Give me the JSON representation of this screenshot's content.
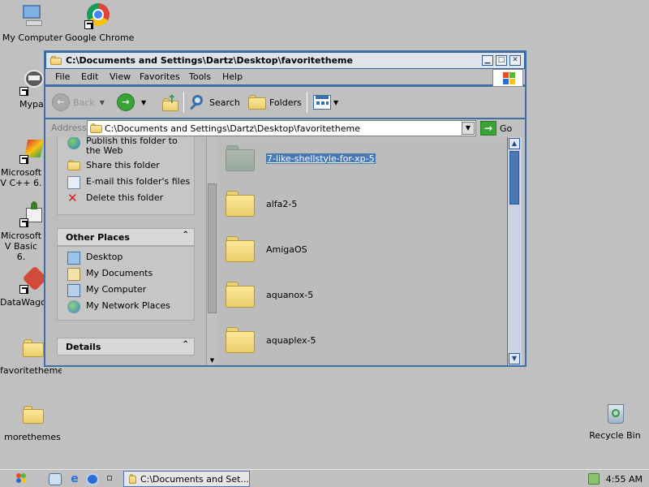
{
  "desktop": {
    "icons": [
      {
        "label": "My Computer"
      },
      {
        "label": "Google Chrome"
      },
      {
        "label": "Mypal"
      },
      {
        "label": "Microsoft V C++ 6."
      },
      {
        "label": "Microsoft V Basic 6."
      },
      {
        "label": "DataWago"
      },
      {
        "label": "favoritetheme"
      },
      {
        "label": "morethemes"
      },
      {
        "label": "Recycle Bin"
      }
    ]
  },
  "window": {
    "title": "C:\\Documents and Settings\\Dartz\\Desktop\\favoritetheme",
    "menu": [
      "File",
      "Edit",
      "View",
      "Favorites",
      "Tools",
      "Help"
    ],
    "toolbar": {
      "back": "Back",
      "search": "Search",
      "folders": "Folders"
    },
    "address": {
      "label": "Address",
      "value": "C:\\Documents and Settings\\Dartz\\Desktop\\favoritetheme",
      "go": "Go"
    },
    "tasks": {
      "file_folder_tasks": [
        {
          "label": "Publish this folder to the Web",
          "icon": "globe-icon"
        },
        {
          "label": "Share this folder",
          "icon": "share-folder-icon"
        },
        {
          "label": "E-mail this folder's files",
          "icon": "email-icon"
        },
        {
          "label": "Delete this folder",
          "icon": "delete-x-icon"
        }
      ],
      "other_places": {
        "title": "Other Places",
        "items": [
          {
            "label": "Desktop",
            "icon": "desktop-icon"
          },
          {
            "label": "My Documents",
            "icon": "my-documents-icon"
          },
          {
            "label": "My Computer",
            "icon": "my-computer-icon"
          },
          {
            "label": "My Network Places",
            "icon": "network-places-icon"
          }
        ]
      },
      "details": {
        "title": "Details"
      }
    },
    "files": [
      {
        "name": "7-like-shellstyle-for-xp-5",
        "selected": true
      },
      {
        "name": "alfa2-5",
        "selected": false
      },
      {
        "name": "AmigaOS",
        "selected": false
      },
      {
        "name": "aquanox-5",
        "selected": false
      },
      {
        "name": "aquaplex-5",
        "selected": false
      }
    ]
  },
  "taskbar": {
    "active_task": "C:\\Documents and Set...",
    "clock": "4:55 AM"
  },
  "colors": {
    "window_frame": "#3f6fa5",
    "selection": "#4a78b5",
    "desktop": "#c0c0c0",
    "folder": "#f5dc86"
  }
}
